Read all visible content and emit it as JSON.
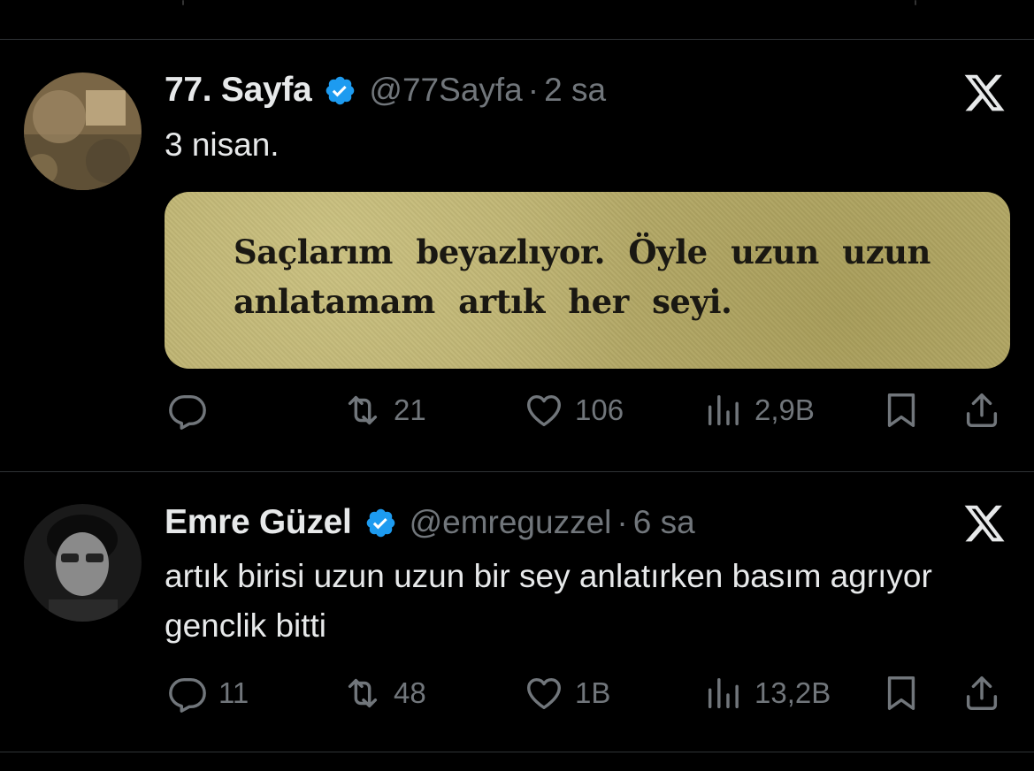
{
  "tweets": [
    {
      "name": "77. Sayfa",
      "handle": "@77Sayfa",
      "separator": "·",
      "time": "2 sa",
      "text": "3 nisan.",
      "quote_image_text": "Saçlarım beyazlıyor. Öyle uzun uzun anlatamam artık her seyi.",
      "actions": {
        "reply": "",
        "retweet": "21",
        "like": "106",
        "views": "2,9B"
      }
    },
    {
      "name": "Emre Güzel",
      "handle": "@emreguzzel",
      "separator": "·",
      "time": "6 sa",
      "text": "artık birisi uzun uzun bir sey anlatırken basım agrıyor genclik bitti",
      "actions": {
        "reply": "11",
        "retweet": "48",
        "like": "1B",
        "views": "13,2B"
      }
    }
  ],
  "colors": {
    "background": "#000000",
    "text": "#e7e9ea",
    "muted": "#71767b",
    "verified": "#1d9bf0",
    "divider": "#2f3336"
  }
}
